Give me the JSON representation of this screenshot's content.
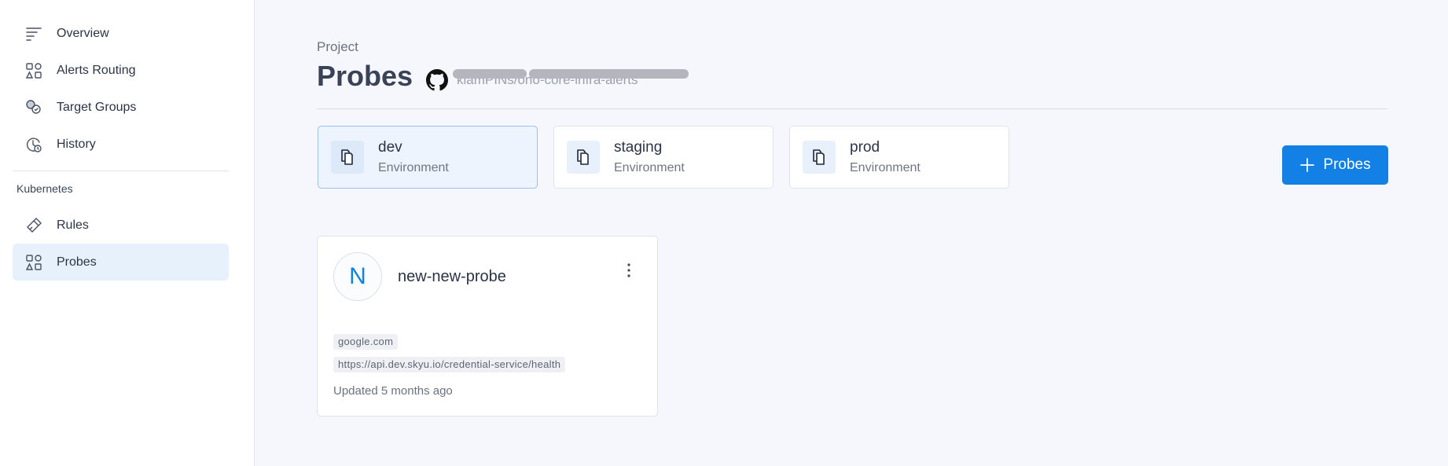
{
  "sidebar": {
    "items": [
      {
        "label": "Overview",
        "icon": "overview-icon"
      },
      {
        "label": "Alerts Routing",
        "icon": "alerts-routing-icon"
      },
      {
        "label": "Target Groups",
        "icon": "target-groups-icon"
      },
      {
        "label": "History",
        "icon": "history-icon"
      }
    ],
    "section_label": "Kubernetes",
    "section_items": [
      {
        "label": "Rules",
        "icon": "rules-icon"
      },
      {
        "label": "Probes",
        "icon": "probes-icon",
        "active": true
      }
    ]
  },
  "header": {
    "project_label": "Project",
    "title": "Probes",
    "repo": "kiamPINs/ono-core-infra-alerts"
  },
  "environments": [
    {
      "name": "dev",
      "subtitle": "Environment",
      "active": true
    },
    {
      "name": "staging",
      "subtitle": "Environment",
      "active": false
    },
    {
      "name": "prod",
      "subtitle": "Environment",
      "active": false
    }
  ],
  "add_button": {
    "label": "Probes",
    "icon": "plus-icon"
  },
  "probe": {
    "avatar_letter": "N",
    "name": "new-new-probe",
    "tags": [
      "google.com",
      "https://api.dev.skyu.io/credential-service/health"
    ],
    "updated": "Updated 5 months ago"
  },
  "colors": {
    "accent": "#1280e4",
    "active_bg": "#e6f1fc",
    "page_bg": "#f5f7fc"
  }
}
